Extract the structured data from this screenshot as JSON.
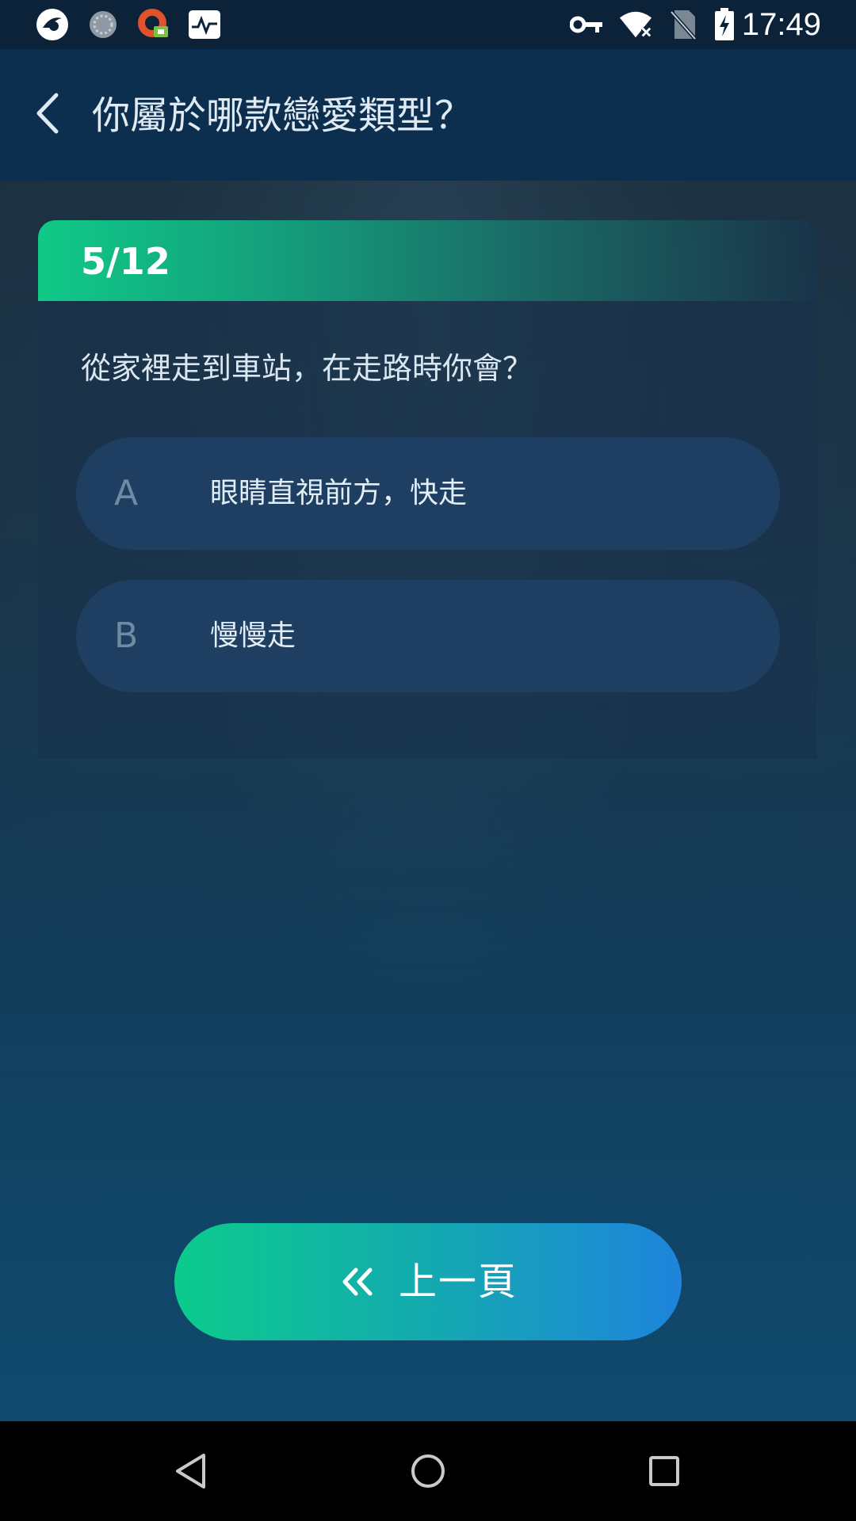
{
  "status_bar": {
    "time": "17:49",
    "left_icons": [
      "app-logo-icon",
      "loading-icon",
      "vpn-app-icon",
      "activity-monitor-icon"
    ],
    "right_icons": [
      "key-icon",
      "wifi-off-icon",
      "no-sim-icon",
      "battery-charging-icon"
    ]
  },
  "app_bar": {
    "back_icon": "chevron-left-icon",
    "title": "你屬於哪款戀愛類型？"
  },
  "quiz": {
    "progress": "5/12",
    "question": "從家裡走到車站，在走路時你會？",
    "options": [
      {
        "letter": "A",
        "text": "眼睛直視前方，快走"
      },
      {
        "letter": "B",
        "text": "慢慢走"
      }
    ]
  },
  "prev_button": {
    "icon": "double-chevron-left-icon",
    "label": "上一頁"
  },
  "nav_bar": {
    "buttons": [
      "back-triangle-icon",
      "home-circle-icon",
      "recents-square-icon"
    ]
  },
  "colors": {
    "accent_green": "#10c987",
    "accent_blue": "#1e84dc",
    "option_bg": "#1e3f62"
  }
}
